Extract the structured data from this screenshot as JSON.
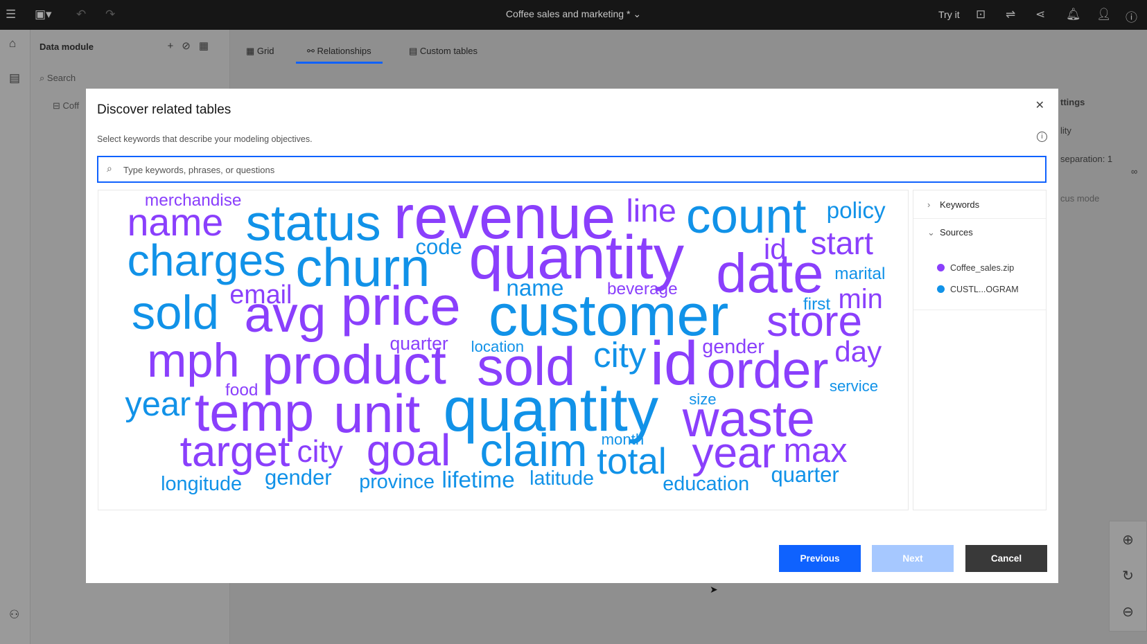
{
  "topbar": {
    "title": "Coffee sales and marketing *",
    "try_it": "Try it"
  },
  "panel": {
    "title": "Data module",
    "search_placeholder": "Search",
    "root_item": "Coff"
  },
  "tabs": [
    {
      "label": "Grid"
    },
    {
      "label": "Relationships",
      "active": true
    },
    {
      "label": "Custom tables"
    }
  ],
  "background_settings": {
    "title": "ttings",
    "item1": "lity",
    "item2": "separation: 1",
    "item3": "cus mode",
    "infinity": "∞"
  },
  "modal": {
    "title": "Discover related tables",
    "subtitle": "Select keywords that describe your modeling objectives.",
    "search_placeholder": "Type keywords, phrases, or questions",
    "search_value": "",
    "words": [
      {
        "text": "merchandise",
        "source": "a"
      },
      {
        "text": "name",
        "source": "a"
      },
      {
        "text": "status",
        "source": "b"
      },
      {
        "text": "revenue",
        "source": "a"
      },
      {
        "text": "line",
        "source": "a"
      },
      {
        "text": "count",
        "source": "b"
      },
      {
        "text": "policy",
        "source": "b"
      },
      {
        "text": "charges",
        "source": "b"
      },
      {
        "text": "churn",
        "source": "b"
      },
      {
        "text": "code",
        "source": "b"
      },
      {
        "text": "quantity",
        "source": "a"
      },
      {
        "text": "id",
        "source": "a"
      },
      {
        "text": "start",
        "source": "a"
      },
      {
        "text": "date",
        "source": "a"
      },
      {
        "text": "marital",
        "source": "b"
      },
      {
        "text": "sold",
        "source": "b"
      },
      {
        "text": "email",
        "source": "a"
      },
      {
        "text": "avg",
        "source": "a"
      },
      {
        "text": "price",
        "source": "a"
      },
      {
        "text": "name",
        "source": "b"
      },
      {
        "text": "beverage",
        "source": "a"
      },
      {
        "text": "customer",
        "source": "b"
      },
      {
        "text": "first",
        "source": "b"
      },
      {
        "text": "min",
        "source": "a"
      },
      {
        "text": "store",
        "source": "a"
      },
      {
        "text": "mph",
        "source": "a"
      },
      {
        "text": "product",
        "source": "a"
      },
      {
        "text": "quarter",
        "source": "a"
      },
      {
        "text": "location",
        "source": "b"
      },
      {
        "text": "sold",
        "source": "a"
      },
      {
        "text": "city",
        "source": "b"
      },
      {
        "text": "id",
        "source": "a"
      },
      {
        "text": "gender",
        "source": "a"
      },
      {
        "text": "day",
        "source": "a"
      },
      {
        "text": "order",
        "source": "a"
      },
      {
        "text": "service",
        "source": "b"
      },
      {
        "text": "year",
        "source": "b"
      },
      {
        "text": "food",
        "source": "a"
      },
      {
        "text": "temp",
        "source": "a"
      },
      {
        "text": "unit",
        "source": "a"
      },
      {
        "text": "quantity",
        "source": "b"
      },
      {
        "text": "size",
        "source": "b"
      },
      {
        "text": "waste",
        "source": "a"
      },
      {
        "text": "target",
        "source": "a"
      },
      {
        "text": "city",
        "source": "a"
      },
      {
        "text": "goal",
        "source": "a"
      },
      {
        "text": "claim",
        "source": "b"
      },
      {
        "text": "month",
        "source": "b"
      },
      {
        "text": "total",
        "source": "b"
      },
      {
        "text": "year",
        "source": "a"
      },
      {
        "text": "max",
        "source": "a"
      },
      {
        "text": "longitude",
        "source": "b"
      },
      {
        "text": "gender",
        "source": "b"
      },
      {
        "text": "province",
        "source": "b"
      },
      {
        "text": "lifetime",
        "source": "b"
      },
      {
        "text": "latitude",
        "source": "b"
      },
      {
        "text": "education",
        "source": "b"
      },
      {
        "text": "quarter",
        "source": "b"
      }
    ],
    "side": {
      "keywords_label": "Keywords",
      "sources_label": "Sources",
      "sources": [
        {
          "name": "Coffee_sales.zip",
          "color": "#8a3ffc"
        },
        {
          "name": "CUSTL...OGRAM",
          "color": "#1192e8"
        }
      ]
    },
    "buttons": {
      "previous": "Previous",
      "next": "Next",
      "cancel": "Cancel"
    },
    "colors": {
      "a": "#8a3ffc",
      "b": "#1192e8",
      "primary": "#0f62fe",
      "disabled": "#a6c8ff",
      "secondary": "#393939"
    }
  }
}
